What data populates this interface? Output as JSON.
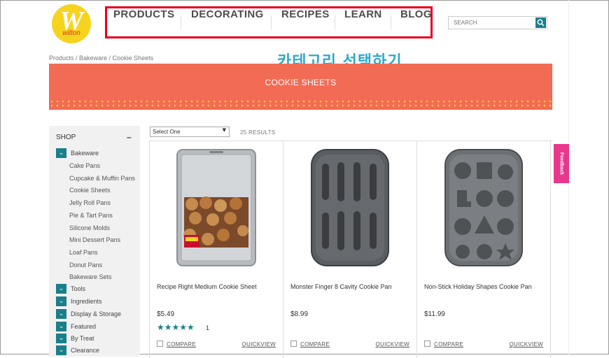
{
  "brand": {
    "logo_letter": "W",
    "logo_text": "wilton"
  },
  "nav": {
    "items": [
      "PRODUCTS",
      "DECORATING",
      "RECIPES",
      "LEARN",
      "BLOG"
    ]
  },
  "search": {
    "placeholder": "SEARCH"
  },
  "breadcrumb": "Products / Bakeware / Cookie Sheets",
  "overlay_caption": "카테고리 선택하기",
  "banner": {
    "title": "COOKIE SHEETS"
  },
  "sidebar": {
    "shop_label": "SHOP",
    "collapse_symbol": "–",
    "categories": [
      "Bakeware",
      "Tools",
      "Ingredients",
      "Display & Storage",
      "Featured",
      "By Treat",
      "Clearance"
    ],
    "bakeware_subitems": [
      "Cake Pans",
      "Cupcake & Muffin Pans",
      "Cookie Sheets",
      "Jelly Roll Pans",
      "Pie & Tart Pans",
      "Silicone Molds",
      "Mini Dessert Pans",
      "Loaf Pans",
      "Donut Pans",
      "Bakeware Sets"
    ]
  },
  "toolbar": {
    "select_value": "Select One",
    "results": "25 RESULTS"
  },
  "products": [
    {
      "name": "Recipe Right Medium Cookie Sheet",
      "price": "$5.49",
      "stars": "★★★★★",
      "rating_count": "1",
      "compare": "COMPARE",
      "quickview": "QUICKVIEW"
    },
    {
      "name": "Monster Finger 8 Cavity Cookie Pan",
      "price": "$8.99",
      "compare": "COMPARE",
      "quickview": "QUICKVIEW"
    },
    {
      "name": "Non-Stick Holiday Shapes Cookie Pan",
      "price": "$11.99",
      "compare": "COMPARE",
      "quickview": "QUICKVIEW"
    }
  ],
  "feedback_label": "Feedback",
  "colors": {
    "accent": "#1a7f8a",
    "banner": "#f26b54",
    "highlight": "#e8001a",
    "feedback": "#e8378c",
    "logo": "#f6d31f"
  }
}
